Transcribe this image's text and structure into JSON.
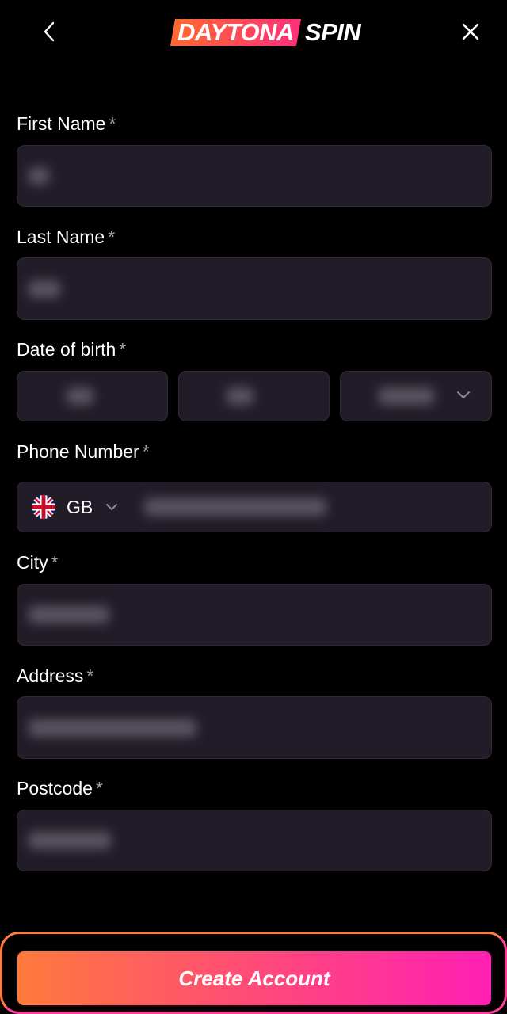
{
  "header": {
    "logo_part1": "DAYTONA",
    "logo_part2": "SPIN",
    "back_icon": "chevron-left-icon",
    "close_icon": "close-icon"
  },
  "form": {
    "first_name": {
      "label": "First Name",
      "required_mark": "*"
    },
    "last_name": {
      "label": "Last Name",
      "required_mark": "*"
    },
    "date_of_birth": {
      "label": "Date of birth",
      "required_mark": "*"
    },
    "phone_number": {
      "label": "Phone Number",
      "required_mark": "*",
      "country_code": "GB",
      "country_flag_icon": "uk-flag-icon"
    },
    "city": {
      "label": "City",
      "required_mark": "*"
    },
    "address": {
      "label": "Address",
      "required_mark": "*"
    },
    "postcode": {
      "label": "Postcode",
      "required_mark": "*"
    }
  },
  "cta": {
    "label": "Create Account"
  },
  "colors": {
    "background": "#000000",
    "field_bg": "#211c27",
    "accent_start": "#ff7a3c",
    "accent_end": "#ff1fb4"
  }
}
